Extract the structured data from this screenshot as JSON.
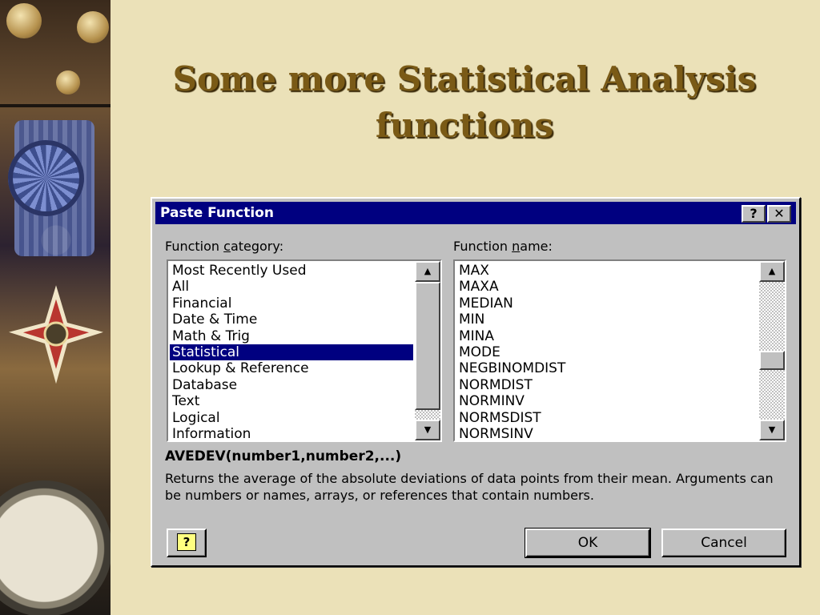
{
  "slide": {
    "title_line1": "Some more Statistical Analysis",
    "title_line2": "functions"
  },
  "dialog": {
    "title": "Paste Function",
    "help_title_button": "?",
    "close_title_button": "✕",
    "category_label_pre": "Function ",
    "category_label_mnemonic": "c",
    "category_label_post": "ategory:",
    "name_label_pre": "Function ",
    "name_label_mnemonic": "n",
    "name_label_post": "ame:",
    "categories": [
      "Most Recently Used",
      "All",
      "Financial",
      "Date & Time",
      "Math & Trig",
      "Statistical",
      "Lookup & Reference",
      "Database",
      "Text",
      "Logical",
      "Information"
    ],
    "selected_category": "Statistical",
    "functions": [
      "MAX",
      "MAXA",
      "MEDIAN",
      "MIN",
      "MINA",
      "MODE",
      "NEGBINOMDIST",
      "NORMDIST",
      "NORMINV",
      "NORMSDIST",
      "NORMSINV"
    ],
    "syntax": "AVEDEV(number1,number2,...)",
    "description": "Returns the average of the absolute deviations of data points from their mean. Arguments can be numbers or names, arrays, or references that contain numbers.",
    "ok_label": "OK",
    "cancel_label": "Cancel",
    "help_button_glyph": "?"
  },
  "colors": {
    "title": "#7a5a16",
    "selection": "#000080",
    "dialog_face": "#c0c0c0",
    "background": "#ebe1b8"
  },
  "icons": [
    "decorative-medal-collage",
    "scroll-up-arrow-icon",
    "scroll-down-arrow-icon",
    "office-assistant-help-icon"
  ]
}
